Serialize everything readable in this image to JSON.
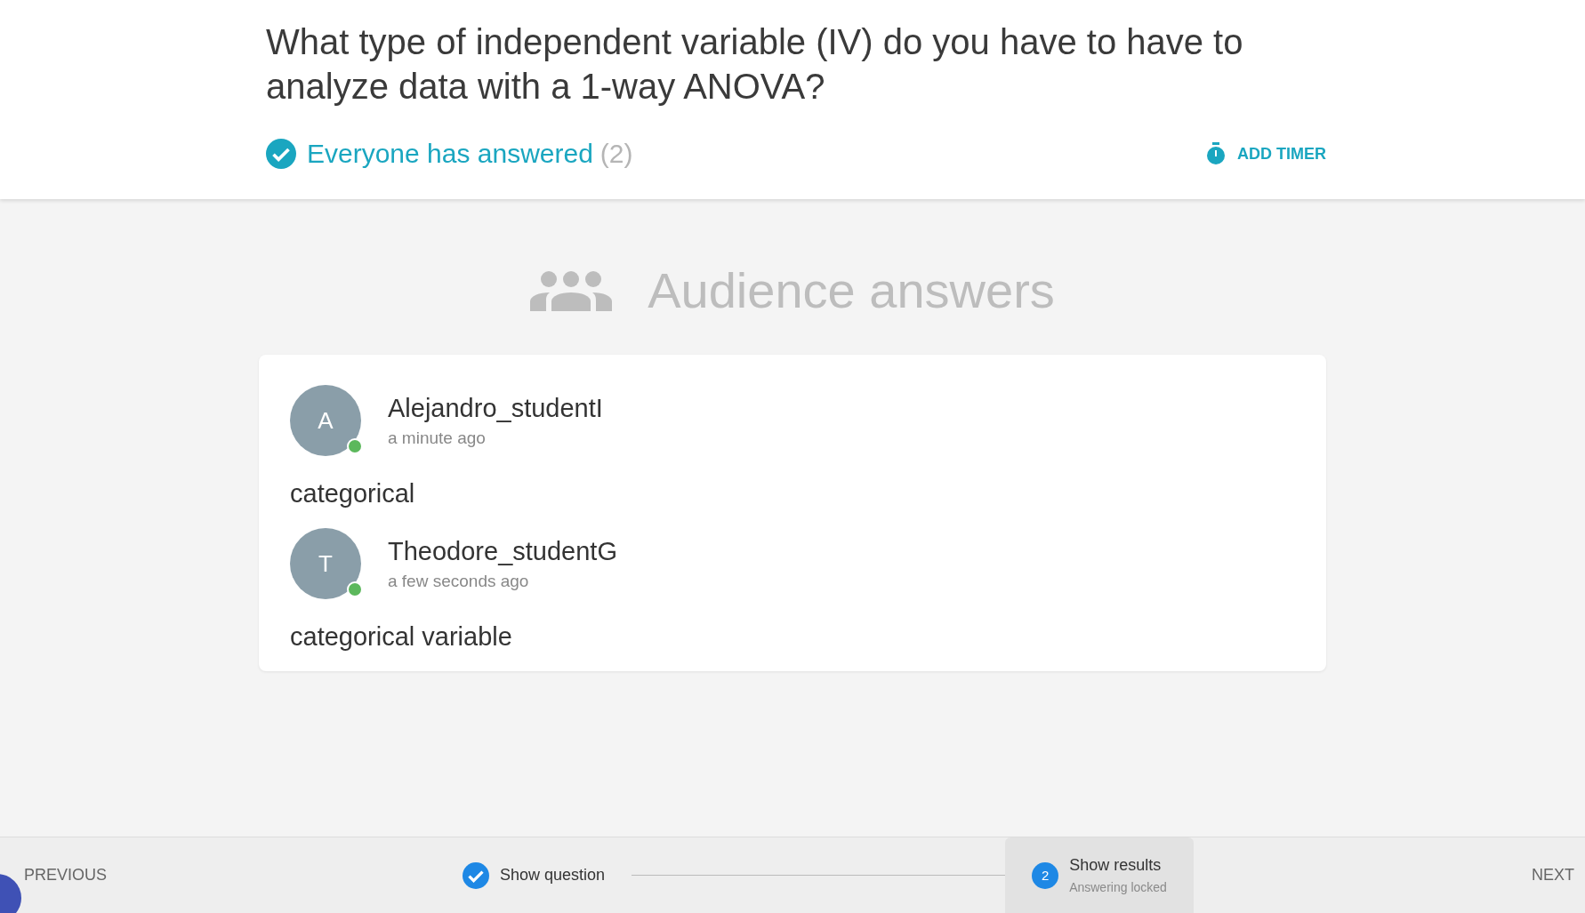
{
  "question": "What type of independent variable (IV) do you have to have to analyze data with a 1-way ANOVA?",
  "status": {
    "label": "Everyone has answered",
    "count": "(2)"
  },
  "timer_button": "ADD TIMER",
  "heading": "Audience answers",
  "answers": [
    {
      "initial": "A",
      "name": "Alejandro_studentI",
      "time": "a minute ago",
      "text": "categorical",
      "online": true
    },
    {
      "initial": "T",
      "name": "Theodore_studentG",
      "time": "a few seconds ago",
      "text": "categorical variable",
      "online": true
    }
  ],
  "footer": {
    "previous": "PREVIOUS",
    "next": "NEXT",
    "steps": [
      {
        "label": "Show question",
        "done": true,
        "selected": false
      },
      {
        "number": "2",
        "label": "Show results",
        "sublabel": "Answering locked",
        "done": false,
        "selected": true
      }
    ]
  }
}
